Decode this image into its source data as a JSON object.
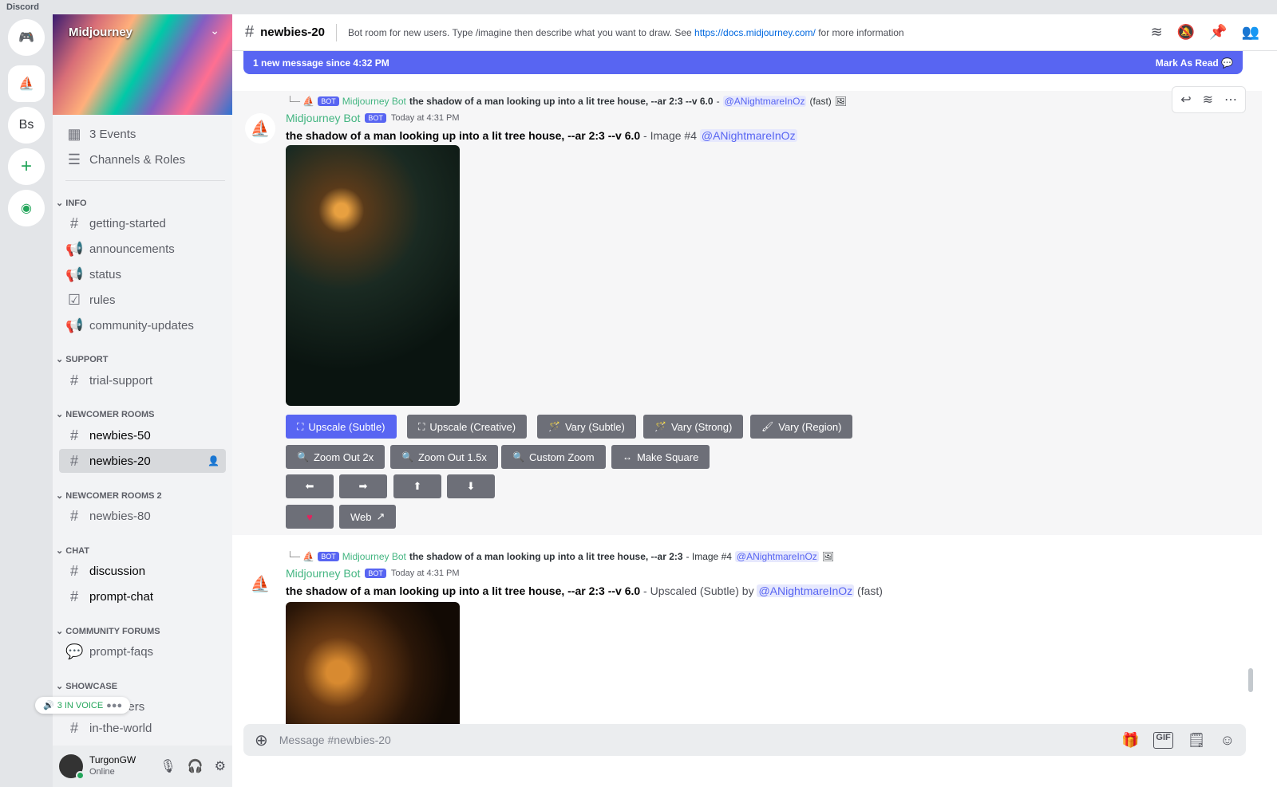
{
  "window": {
    "title": "Discord"
  },
  "servers": [
    {
      "label": "Bs"
    }
  ],
  "server": {
    "name": "Midjourney"
  },
  "sidebar": {
    "top": [
      {
        "label": "3 Events",
        "icon": "calendar-icon"
      },
      {
        "label": "Channels & Roles",
        "icon": "channels-roles-icon"
      }
    ],
    "categories": [
      {
        "name": "INFO",
        "channels": [
          {
            "label": "getting-started",
            "icon": "#"
          },
          {
            "label": "announcements",
            "icon": "megaphone-icon"
          },
          {
            "label": "status",
            "icon": "megaphone-icon"
          },
          {
            "label": "rules",
            "icon": "checkbox-icon"
          },
          {
            "label": "community-updates",
            "icon": "megaphone-icon"
          }
        ]
      },
      {
        "name": "SUPPORT",
        "channels": [
          {
            "label": "trial-support"
          }
        ]
      },
      {
        "name": "NEWCOMER ROOMS",
        "channels": [
          {
            "label": "newbies-50",
            "unread": true
          },
          {
            "label": "newbies-20",
            "selected": true
          }
        ]
      },
      {
        "name": "NEWCOMER ROOMS 2",
        "channels": [
          {
            "label": "newbies-80"
          }
        ]
      },
      {
        "name": "CHAT",
        "channels": [
          {
            "label": "discussion",
            "unread": true
          },
          {
            "label": "prompt-chat",
            "unread": true
          }
        ]
      },
      {
        "name": "COMMUNITY FORUMS",
        "channels": [
          {
            "label": "prompt-faqs"
          }
        ]
      },
      {
        "name": "SHOWCASE",
        "channels": [
          {
            "label": "paintovers"
          },
          {
            "label": "in-the-world"
          }
        ]
      }
    ],
    "voice": "3 IN VOICE"
  },
  "user": {
    "name": "TurgonGW",
    "status": "Online"
  },
  "header": {
    "channel": "newbies-20",
    "topic": "Bot room for new users. Type /imagine then describe what you want to draw. See",
    "link": "https://docs.midjourney.com/",
    "topic_end": "for more information"
  },
  "banner": {
    "text": "1 new message since 4:32 PM",
    "action": "Mark As Read"
  },
  "messages": [
    {
      "reply_author": "Midjourney Bot",
      "reply_text": "the shadow of a man looking up into a lit tree house, --ar 2:3 --v 6.0",
      "reply_sep": " - ",
      "reply_mention": "@ANightmareInOz",
      "reply_suffix": "(fast)",
      "author": "Midjourney Bot",
      "badge": "BOT",
      "time": "Today at 4:31 PM",
      "prompt": "the shadow of a man looking up into a lit tree house, --ar 2:3 --v 6.0",
      "suffix": " - Image #4 ",
      "mention": "@ANightmareInOz",
      "buttons": {
        "row1": [
          "Upscale (Subtle)",
          "Upscale (Creative)",
          "Vary (Subtle)",
          "Vary (Strong)",
          "Vary (Region)"
        ],
        "row2": [
          "Zoom Out 2x",
          "Zoom Out 1.5x",
          "Custom Zoom",
          "Make Square"
        ],
        "web": "Web"
      }
    },
    {
      "reply_author": "Midjourney Bot",
      "reply_text": "the shadow of a man looking up into a lit tree house, --ar 2:3",
      "reply_sep": " - Image #4 ",
      "reply_mention": "@ANightmareInOz",
      "author": "Midjourney Bot",
      "badge": "BOT",
      "time": "Today at 4:31 PM",
      "prompt": "the shadow of a man looking up into a lit tree house, --ar 2:3 --v 6.0",
      "suffix": " - Upscaled (Subtle) by ",
      "mention": "@ANightmareInOz",
      "tail": " (fast)"
    }
  ],
  "composer": {
    "placeholder": "Message #newbies-20"
  },
  "colors": {
    "accent": "#5865f2",
    "bot_name": "#43b581",
    "button": "#6d6f78",
    "online": "#23a55a"
  }
}
